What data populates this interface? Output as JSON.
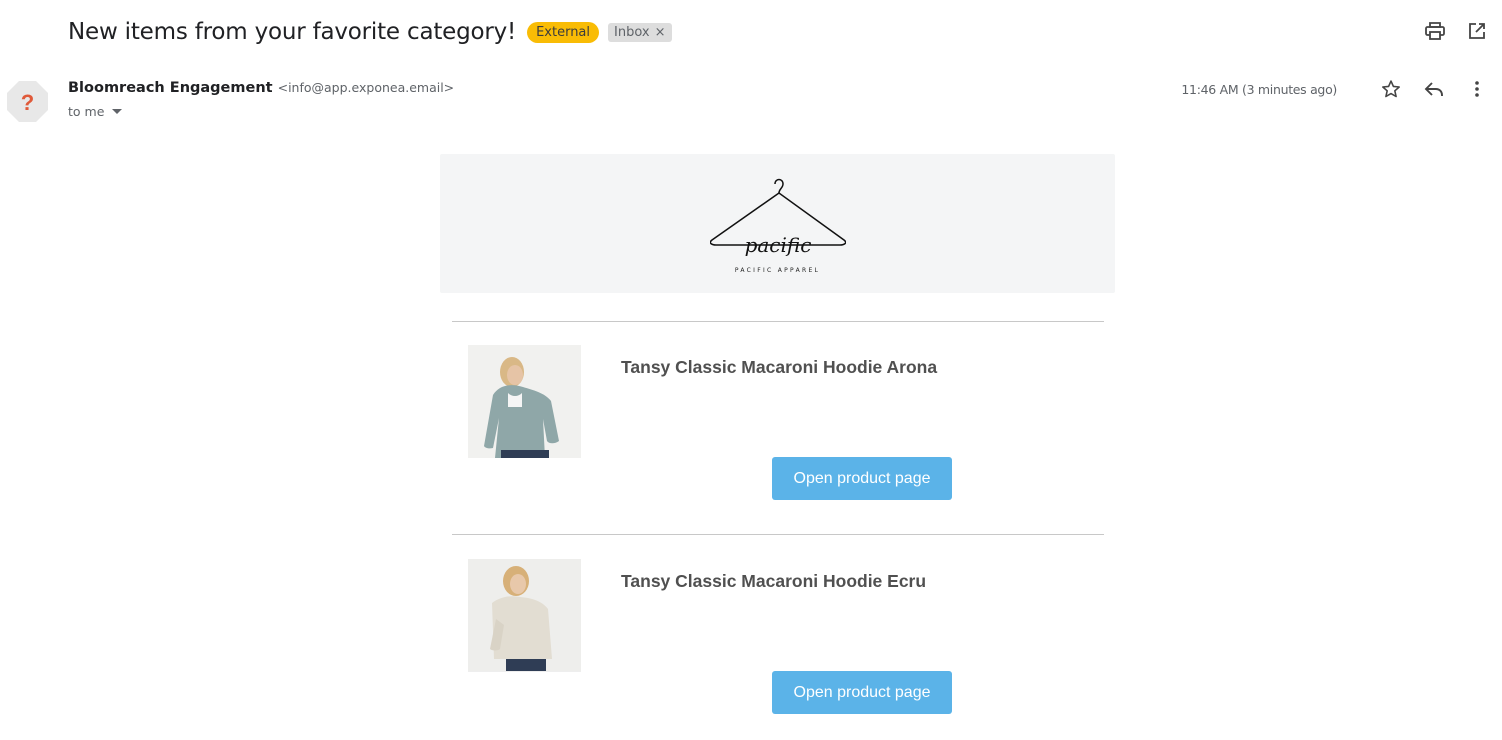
{
  "email": {
    "subject": "New items from your favorite category!",
    "labels": {
      "external": "External",
      "inbox": "Inbox",
      "inbox_remove": "×"
    },
    "sender": {
      "name": "Bloomreach Engagement",
      "email": "<info@app.exponea.email>",
      "to": "to me",
      "avatar_glyph": "?"
    },
    "timestamp": "11:46 AM (3 minutes ago)",
    "icons": {
      "print": "print-icon",
      "open_new_window": "open-in-new-window-icon",
      "star": "star-icon",
      "reply": "reply-icon",
      "more": "more-vert-icon",
      "avatar": "unknown-sender-icon"
    }
  },
  "newsletter": {
    "brand": {
      "script": "pacific",
      "caption": "PACIFIC APPAREL"
    },
    "products": [
      {
        "name": "Tansy Classic Macaroni Hoodie Arona",
        "button_label": "Open product page",
        "image_color": "#8fa7a8"
      },
      {
        "name": "Tansy Classic Macaroni Hoodie Ecru",
        "button_label": "Open product page",
        "image_color": "#e2ddd2"
      }
    ],
    "colors": {
      "button": "#5bb3e8",
      "banner": "#f4f5f6",
      "external_badge": "#f9bc05"
    }
  }
}
